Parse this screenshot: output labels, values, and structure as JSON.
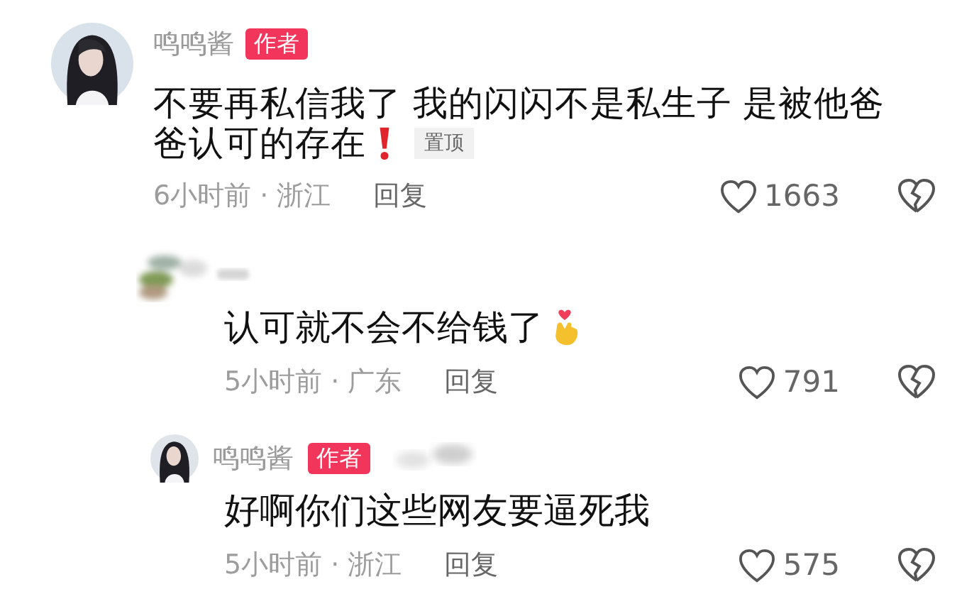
{
  "comments": [
    {
      "avatar": {
        "kind": "figure"
      },
      "author": "鸣鸣酱",
      "badge": "作者",
      "text_lines": [
        "不要再私信我了 我的闪闪不是私生子 是被他爸",
        "爸认可的存在"
      ],
      "trailing_emoji": {
        "kind": "exclamation"
      },
      "pinned": "置顶",
      "meta": "6小时前 · 浙江",
      "reply": "回复",
      "likes": "1663",
      "replies": [
        {
          "avatar": {
            "kind": "blurred"
          },
          "name_blurred": true,
          "text": "认可就不会不给钱了",
          "trailing_emoji": {
            "kind": "finger-heart"
          },
          "meta": "5小时前 · 广东",
          "reply": "回复",
          "likes": "791"
        },
        {
          "avatar": {
            "kind": "figure"
          },
          "author": "鸣鸣酱",
          "badge": "作者",
          "after_name_blurred": true,
          "text": "好啊你们这些网友要逼死我",
          "meta": "5小时前 · 浙江",
          "reply": "回复",
          "likes": "575"
        }
      ]
    }
  ]
}
